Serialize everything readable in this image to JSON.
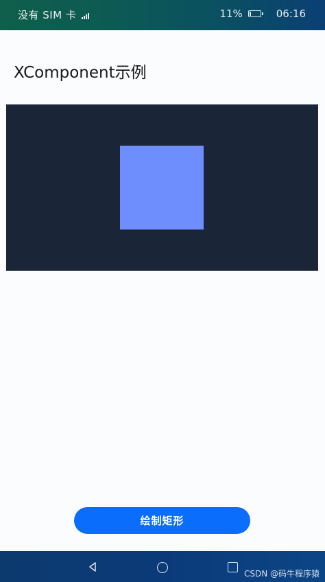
{
  "status_bar": {
    "carrier": "没有 SIM 卡",
    "battery": "11%",
    "time": "06:16"
  },
  "page": {
    "title": "XComponent示例"
  },
  "button": {
    "label": "绘制矩形"
  },
  "watermark": "CSDN @码牛程序猿",
  "colors": {
    "canvas_bg": "#1a2537",
    "rectangle": "#6e8efd",
    "button": "#0a6dfb"
  }
}
